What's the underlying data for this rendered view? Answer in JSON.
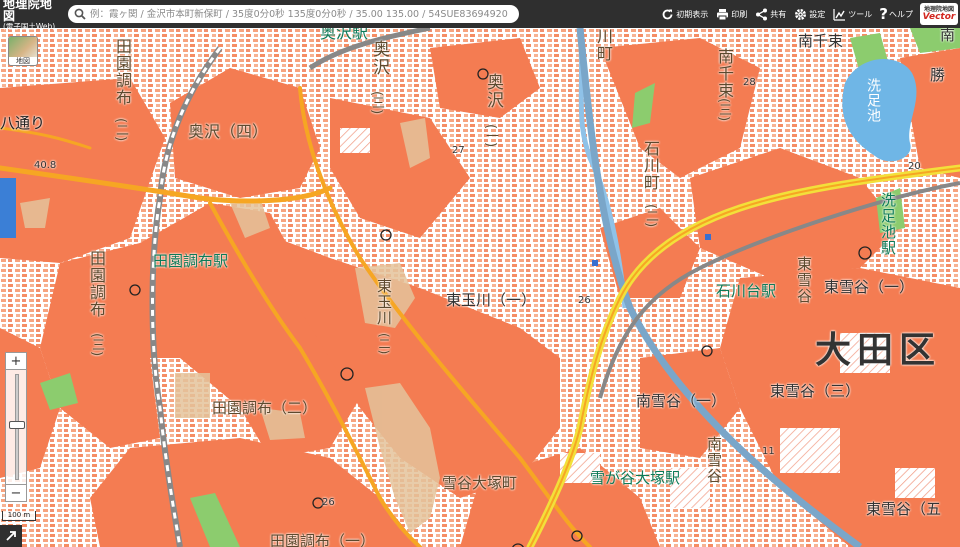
{
  "header": {
    "brand_title": "地理院地図",
    "brand_subtitle": "(電子国土Web)",
    "search_placeholder": "例：霞ヶ関 / 金沢市本町新保町 / 35度0分0秒 135度0分0秒 / 35.00 135.00 / 54SUE83694920",
    "tools": [
      {
        "label": "初期表示",
        "icon": "reset-icon"
      },
      {
        "label": "印刷",
        "icon": "print-icon"
      },
      {
        "label": "共有",
        "icon": "share-icon"
      },
      {
        "label": "設定",
        "icon": "gear-icon"
      },
      {
        "label": "ツール",
        "icon": "tools-icon"
      },
      {
        "label": "ヘルプ",
        "icon": "help-icon"
      }
    ],
    "logo_top": "地理院地図",
    "logo_bottom": "Vector"
  },
  "controls": {
    "layer_button_label": "地図",
    "zoom_in": "+",
    "zoom_out": "−",
    "zoom_level_fraction": 0.48,
    "scale_label": "100 m"
  },
  "colors": {
    "urban": "#f47c52",
    "road_major": "#f6a623",
    "road_yellow": "#f3e03a",
    "rail": "#7aa6c9",
    "water": "#6fb6e6",
    "park": "#8ccc6e",
    "station_text": "#0d7a57"
  },
  "map_labels": {
    "okusawa_eki": "奥沢駅",
    "okusawa_v": "奥沢",
    "okusawa_3": "(三)",
    "okusawa_4": "奥沢（四）",
    "okusawa2_v": "奥沢",
    "okusawa2_n": "(一)",
    "hachiman_dori": "八通り",
    "den_chofu_v": "田園調布",
    "den_chofu_2": "(二)",
    "den_chofu_v2": "田園調布",
    "den_chofu_3": "(三)",
    "den_chofu_station": "田園調布駅",
    "den_chofu_2b": "田園調布（二）",
    "ishikawa_v": "石川町",
    "ishikawa_2": "(二)",
    "kawa_v": "川町",
    "higashi_tamagawa_1": "東玉川（一）",
    "higashi_tamagawa_v": "東玉川",
    "higashi_tamagawa_2": "(二)",
    "ishikawadai_eki": "石川台駅",
    "minami_senzoku_v": "南千束",
    "minami_senzoku_3": "(三)",
    "senzoku_ike": "洗足池",
    "senzoku_ike_eki": "洗足池駅",
    "minami_senzoku_top": "南千束",
    "katsu": "勝",
    "higashi_yukigaya_1": "東雪谷（一）",
    "higashi_yukigaya_v": "東雪谷",
    "higashi_yukigaya_3": "東雪谷（三）",
    "higashi_yukigaya_5": "東雪谷（五",
    "minami_yukigaya_1": "南雪谷（一）",
    "minami_yukigaya_v": "南雪谷",
    "yukigaya_otsuka": "雪谷大塚町",
    "yukigaya_otsuka_eki": "雪が谷大塚駅",
    "ota_ku": "大田区",
    "den_chofu_1b": "田園調布（一）",
    "kugahara_top": "南",
    "e_40_8": "40.8",
    "e_27": "27",
    "e_26": "26",
    "e_28": "28",
    "e_20": "20",
    "e_11": "11",
    "e_26b": "26"
  }
}
